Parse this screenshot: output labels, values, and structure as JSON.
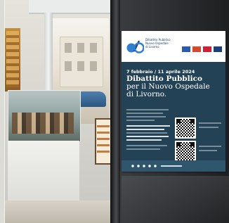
{
  "photo": {
    "description_alt": "",
    "poster": {
      "org_line_1": "Dibattito Pubblico",
      "org_line_2": "Nuovo Ospedale",
      "org_line_3": "di Livorno",
      "date_range": "7 febbraio / 11 aprile 2024",
      "title_line_1": "Dibattito Pubblico",
      "title_line_2": "per il Nuovo Ospedale",
      "title_line_3": "di Livorno.",
      "colors": {
        "poster_bg": "#244255",
        "header_bg": "#ffffff",
        "logo_blue": "#2f7fd0",
        "logo_navy": "#1d3c6e"
      },
      "icons": [
        "logo-mark",
        "qr-code",
        "qr-code"
      ]
    },
    "scene": {
      "store_signage": "",
      "door_color": "#2b2c2e"
    }
  }
}
